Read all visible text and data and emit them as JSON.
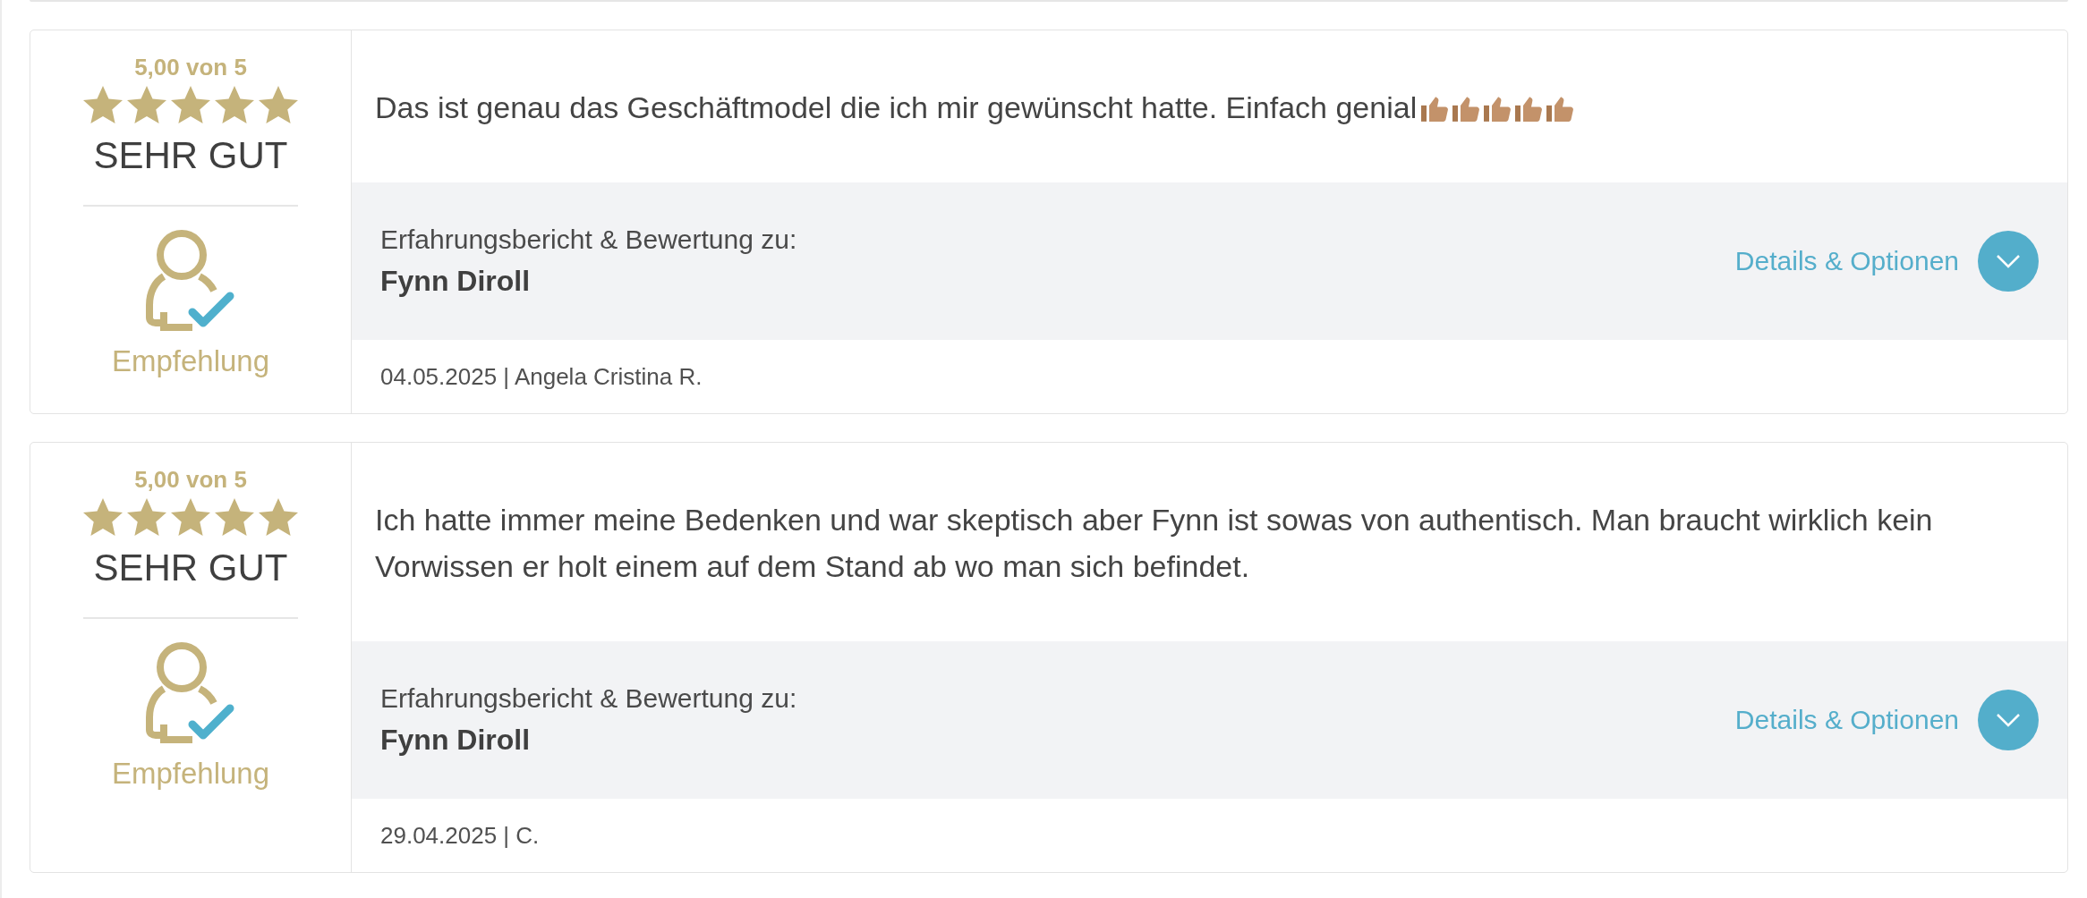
{
  "reviews": [
    {
      "rating": {
        "score": "5,00 von 5",
        "stars": 5,
        "verdict": "SEHR GUT",
        "badge": "Empfehlung"
      },
      "text": "Das ist genau das Geschäftmodel die ich mir gewünscht hatte. Einfach genial",
      "emojis": [
        {
          "kind": "thumbs-up"
        },
        {
          "kind": "thumbs-up"
        },
        {
          "kind": "thumbs-up"
        },
        {
          "kind": "thumbs-up"
        },
        {
          "kind": "thumbs-up"
        }
      ],
      "subject": {
        "label": "Erfahrungsbericht & Bewertung zu:",
        "name": "Fynn Diroll"
      },
      "details": {
        "label": "Details & Optionen",
        "expanded": false
      },
      "meta": "04.05.2025 | Angela Cristina R."
    },
    {
      "rating": {
        "score": "5,00 von 5",
        "stars": 5,
        "verdict": "SEHR GUT",
        "badge": "Empfehlung"
      },
      "text": "Ich hatte immer meine Bedenken und war skeptisch aber Fynn ist sowas von authentisch. Man braucht wirklich kein Vorwissen er holt einem auf dem Stand ab wo man sich befindet.",
      "subject": {
        "label": "Erfahrungsbericht & Bewertung zu:",
        "name": "Fynn Diroll"
      },
      "details": {
        "label": "Details & Optionen",
        "expanded": false
      },
      "meta": "29.04.2025 | C."
    }
  ]
}
